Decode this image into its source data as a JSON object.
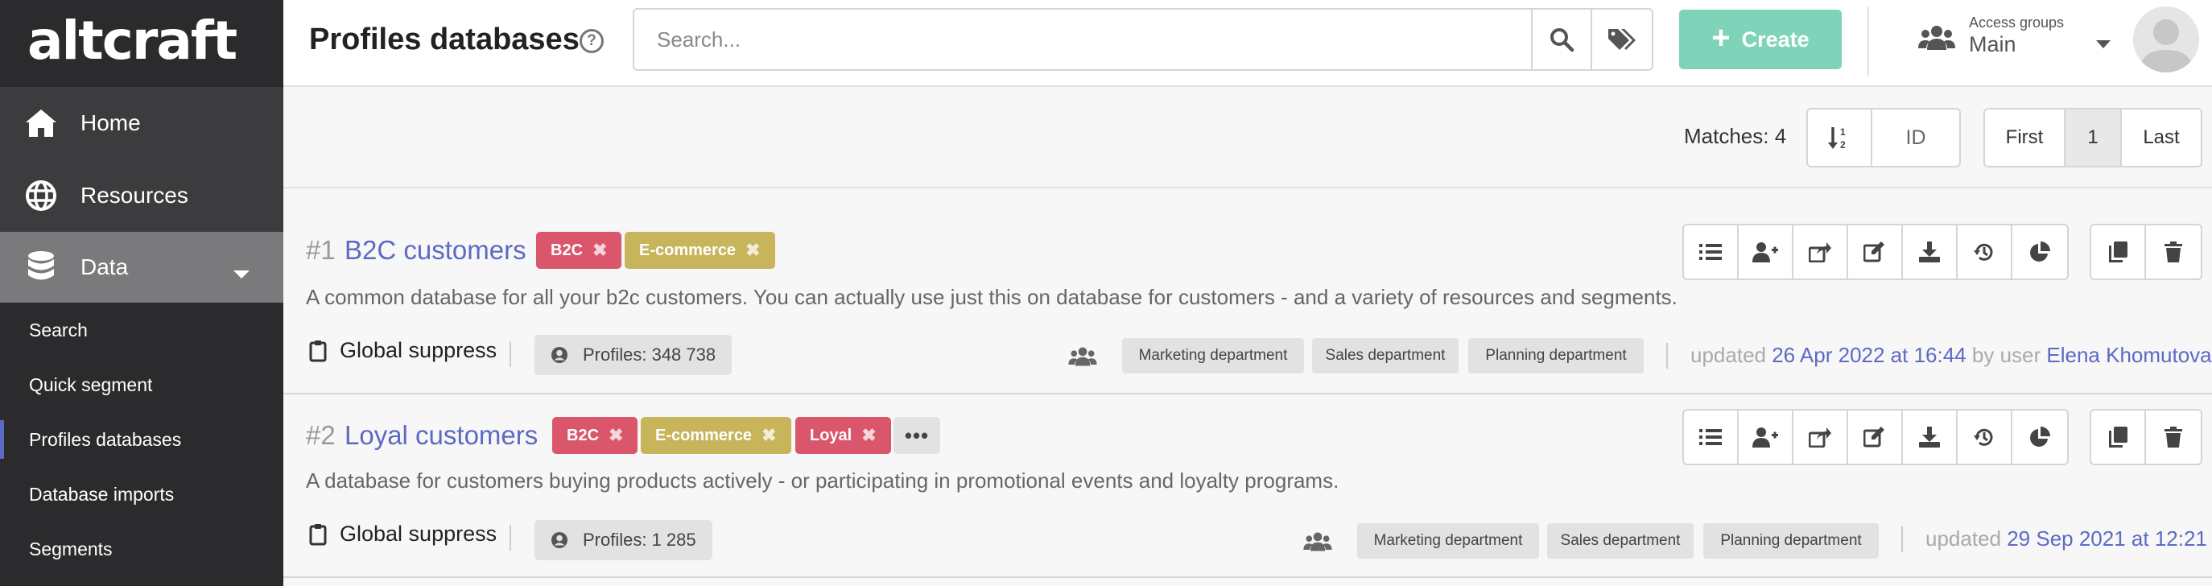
{
  "sidebar": {
    "logo": "altcraft",
    "nav": [
      {
        "label": "Home",
        "icon": "home-icon"
      },
      {
        "label": "Resources",
        "icon": "globe-icon"
      },
      {
        "label": "Data",
        "icon": "database-icon"
      }
    ],
    "sub_items": [
      {
        "label": "Search"
      },
      {
        "label": "Quick segment"
      },
      {
        "label": "Profiles databases"
      },
      {
        "label": "Database imports"
      },
      {
        "label": "Segments"
      }
    ]
  },
  "header": {
    "title": "Profiles databases",
    "help_icon": "?",
    "search_placeholder": "Search...",
    "create_label": "Create",
    "access_groups_label": "Access groups",
    "access_groups_value": "Main"
  },
  "toolbar": {
    "matches": "Matches: 4",
    "sort_field": "ID",
    "pager": {
      "first": "First",
      "page": "1",
      "last": "Last"
    }
  },
  "databases": [
    {
      "num": "#1",
      "title": "B2C customers",
      "tags": [
        "B2C",
        "E-commerce"
      ],
      "tag_close": "✖",
      "description": "A common database for all your b2c customers. You can actually use just this on database for customers - and a variety of resources and segments.",
      "suppress": "Global suppress",
      "profiles": "Profiles: 348 738",
      "departments": [
        "Marketing department",
        "Sales department",
        "Planning department"
      ],
      "updated_prefix": "updated",
      "updated_date": "26 Apr 2022 at 16:44",
      "updated_by": "by user",
      "updated_user": "Elena Khomutova"
    },
    {
      "num": "#2",
      "title": "Loyal customers",
      "tags": [
        "B2C",
        "E-commerce",
        "Loyal"
      ],
      "tag_close": "✖",
      "more": "•••",
      "description": "A database for customers buying products actively - or participating in promotional events and loyalty programs.",
      "suppress": "Global suppress",
      "profiles": "Profiles: 1 285",
      "departments": [
        "Marketing department",
        "Sales department",
        "Planning department"
      ],
      "updated_prefix": "updated",
      "updated_date": "29 Sep 2021 at 12:21"
    }
  ],
  "colors": {
    "sidebar_bg": "#2b2b2e",
    "accent": "#5c6ac4",
    "create": "#7ed3b8",
    "tag_red": "#d9566b",
    "tag_gold": "#c8b45a"
  }
}
